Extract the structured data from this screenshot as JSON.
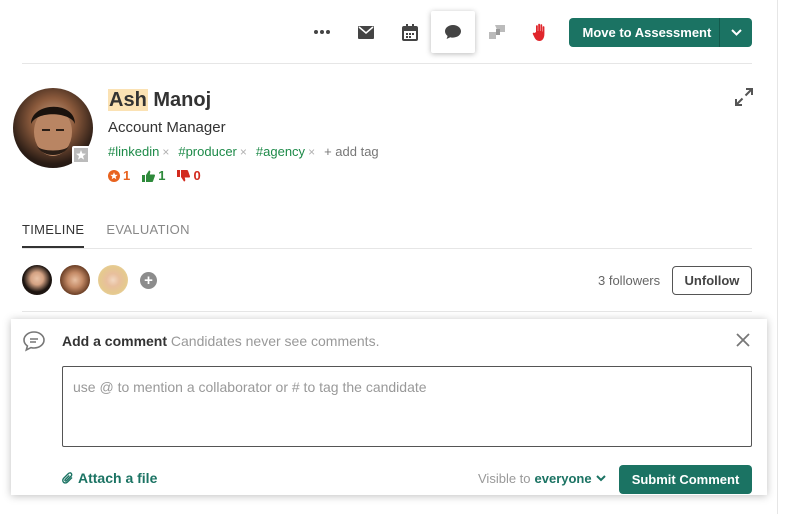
{
  "toolbar": {
    "move_label": "Move to Assessment",
    "icons": [
      "more-icon",
      "email-icon",
      "calendar-icon",
      "comment-icon",
      "feedback-icon",
      "reject-hand-icon",
      "chevron-down-icon"
    ],
    "accent": "#1b7363",
    "reject_color": "#e0262c"
  },
  "candidate": {
    "first_name": "Ash",
    "last_name": "Manoj",
    "title": "Account Manager",
    "tags": [
      "#linkedin",
      "#producer",
      "#agency"
    ],
    "tag_remove": "×",
    "add_tag": "+ add tag",
    "stats": {
      "rating": "1",
      "thumbs_up": "1",
      "thumbs_down": "0"
    },
    "stat_colors": {
      "rating": "#e8631f",
      "up": "#2e8a3b",
      "down": "#d22a1e"
    }
  },
  "tabs": [
    {
      "label": "TIMELINE",
      "active": true
    },
    {
      "label": "EVALUATION",
      "active": false
    }
  ],
  "followers": {
    "count_label": "3 followers",
    "unfollow_label": "Unfollow",
    "add_symbol": "+"
  },
  "comment": {
    "title": "Add a comment",
    "hint": "Candidates never see comments.",
    "placeholder": "use @ to mention a collaborator or # to tag the candidate",
    "attach_label": "Attach a file",
    "visible_prefix": "Visible to",
    "visible_value": "everyone",
    "submit_label": "Submit Comment"
  }
}
